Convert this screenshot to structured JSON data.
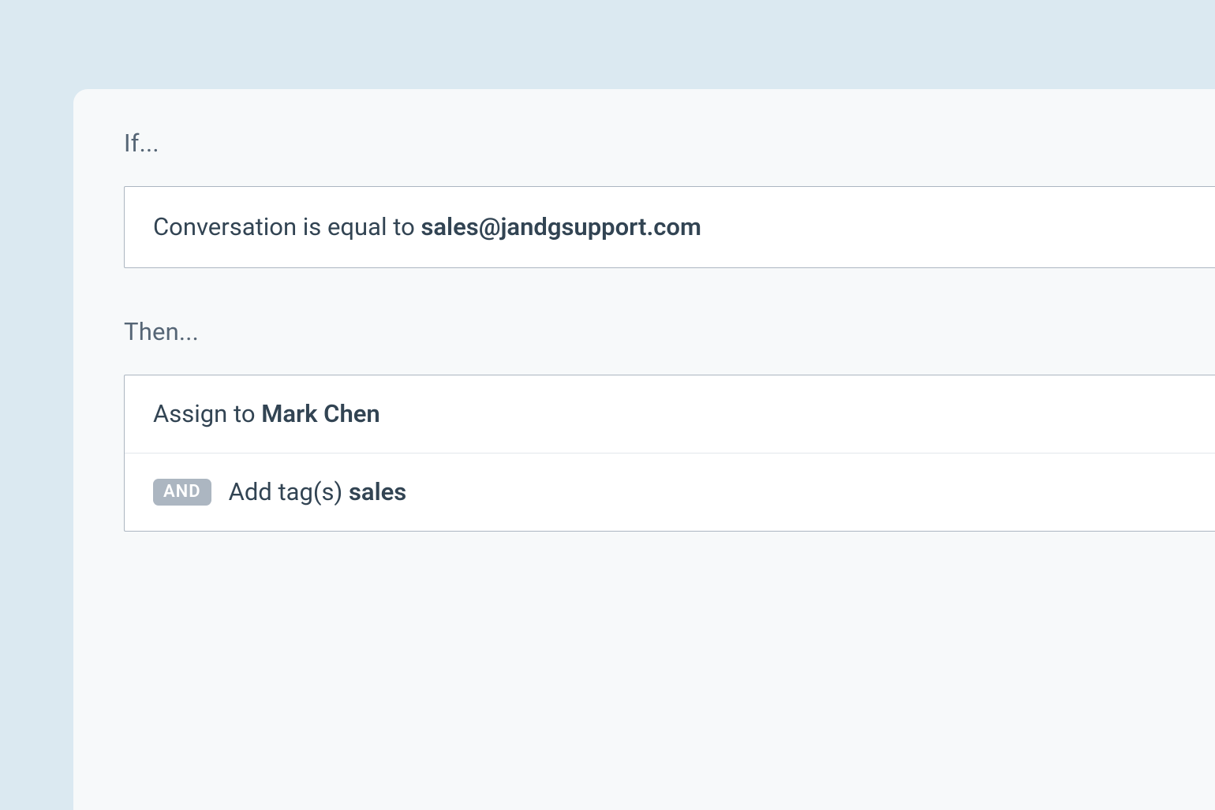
{
  "if_section": {
    "label": "If...",
    "condition": {
      "prefix": "Conversation is equal to ",
      "value": "sales@jandgsupport.com"
    }
  },
  "then_section": {
    "label": "Then...",
    "actions": [
      {
        "prefix": "Assign to ",
        "value": "Mark Chen"
      },
      {
        "operator": "AND",
        "prefix": "Add tag(s) ",
        "value": "sales"
      }
    ]
  }
}
